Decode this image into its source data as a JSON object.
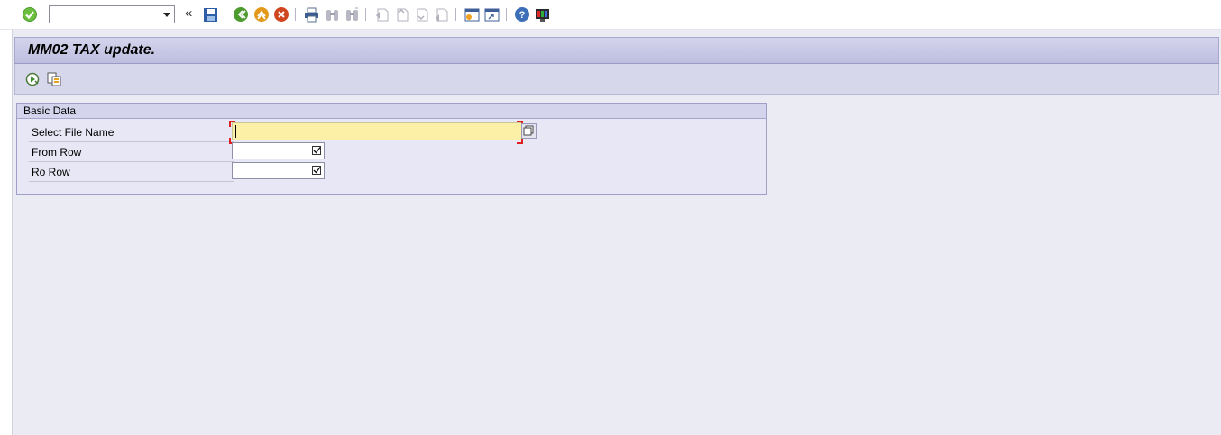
{
  "toolbar": {
    "command_field_value": "",
    "collapse_glyph": "«",
    "icons": [
      "enter-icon",
      "save-icon",
      "back-icon",
      "exit-icon",
      "cancel-icon",
      "print-icon",
      "find-icon",
      "find-next-icon",
      "first-page-icon",
      "previous-page-icon",
      "next-page-icon",
      "last-page-icon",
      "create-session-icon",
      "shortcut-icon",
      "help-icon",
      "customize-layout-icon"
    ]
  },
  "page": {
    "title": "MM02 TAX update."
  },
  "app_toolbar": {
    "icons": [
      "execute-icon",
      "get-variant-icon"
    ]
  },
  "basic_data": {
    "title": "Basic Data",
    "fields": [
      {
        "label": "Select File Name",
        "value": "",
        "required": true
      },
      {
        "label": "From Row",
        "value": "",
        "checkbox": true
      },
      {
        "label": "Ro Row",
        "value": "",
        "checkbox": true
      }
    ]
  },
  "colors": {
    "title_bar": "#c8c8e6",
    "app_toolbar": "#d7d7ec",
    "main_background": "#ebebf4",
    "required_field": "#fbf0a6"
  }
}
